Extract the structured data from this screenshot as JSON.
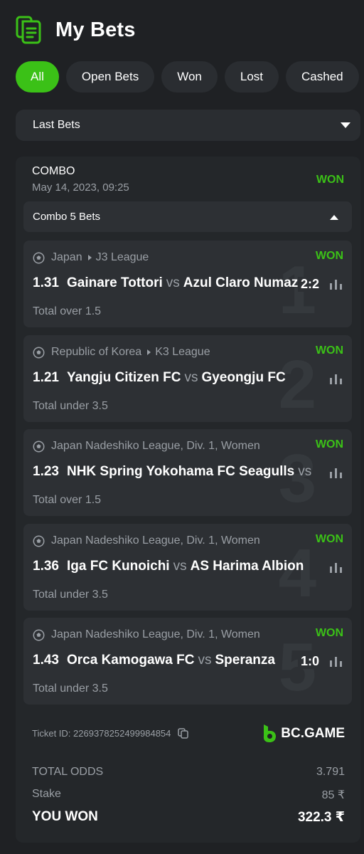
{
  "header": {
    "title": "My Bets",
    "icon": "receipt-icon"
  },
  "tabs": [
    {
      "label": "All",
      "active": true
    },
    {
      "label": "Open Bets",
      "active": false
    },
    {
      "label": "Won",
      "active": false
    },
    {
      "label": "Lost",
      "active": false
    },
    {
      "label": "Cashed",
      "active": false
    }
  ],
  "filter": {
    "value": "Last Bets"
  },
  "bet": {
    "type": "COMBO",
    "date": "May 14, 2023, 09:25",
    "status": "WON",
    "combo_label": "Combo 5 Bets",
    "legs": [
      {
        "number": "1",
        "country": "Japan",
        "league": "J3 League",
        "status": "WON",
        "odd": "1.31",
        "home": "Gainare Tottori",
        "vs": "vs",
        "away": "Azul Claro Numazu",
        "score": "2:2",
        "market": "Total over 1.5"
      },
      {
        "number": "2",
        "country": "Republic of Korea",
        "league": "K3 League",
        "status": "WON",
        "odd": "1.21",
        "home": "Yangju Citizen FC",
        "vs": "vs",
        "away": "Gyeongju FC",
        "score": "",
        "market": "Total under 3.5"
      },
      {
        "number": "3",
        "country": "Japan Nadeshiko League, Div. 1, Women",
        "league": "",
        "status": "WON",
        "odd": "1.23",
        "home": "NHK Spring Yokohama FC Seagulls",
        "vs": "vs",
        "away": "",
        "score": "",
        "market": "Total over 1.5"
      },
      {
        "number": "4",
        "country": "Japan Nadeshiko League, Div. 1, Women",
        "league": "",
        "status": "WON",
        "odd": "1.36",
        "home": "Iga FC Kunoichi",
        "vs": "vs",
        "away": "AS Harima Albion",
        "score": "",
        "market": "Total under 3.5"
      },
      {
        "number": "5",
        "country": "Japan Nadeshiko League, Div. 1, Women",
        "league": "",
        "status": "WON",
        "odd": "1.43",
        "home": "Orca Kamogawa FC",
        "vs": "vs",
        "away": "Speranza",
        "score": "1:0",
        "market": "Total under 3.5"
      }
    ],
    "ticket_id": "Ticket ID: 2269378252499984854",
    "brand": "BC.GAME",
    "totals": {
      "odds_label": "TOTAL ODDS",
      "odds_value": "3.791",
      "stake_label": "Stake",
      "stake_value": "85 ₹",
      "won_label": "YOU WON",
      "won_value": "322.3 ₹"
    }
  },
  "colors": {
    "accent": "#3bc117",
    "background": "#1f2124",
    "card": "#24272a",
    "muted": "#9a9fa5"
  }
}
